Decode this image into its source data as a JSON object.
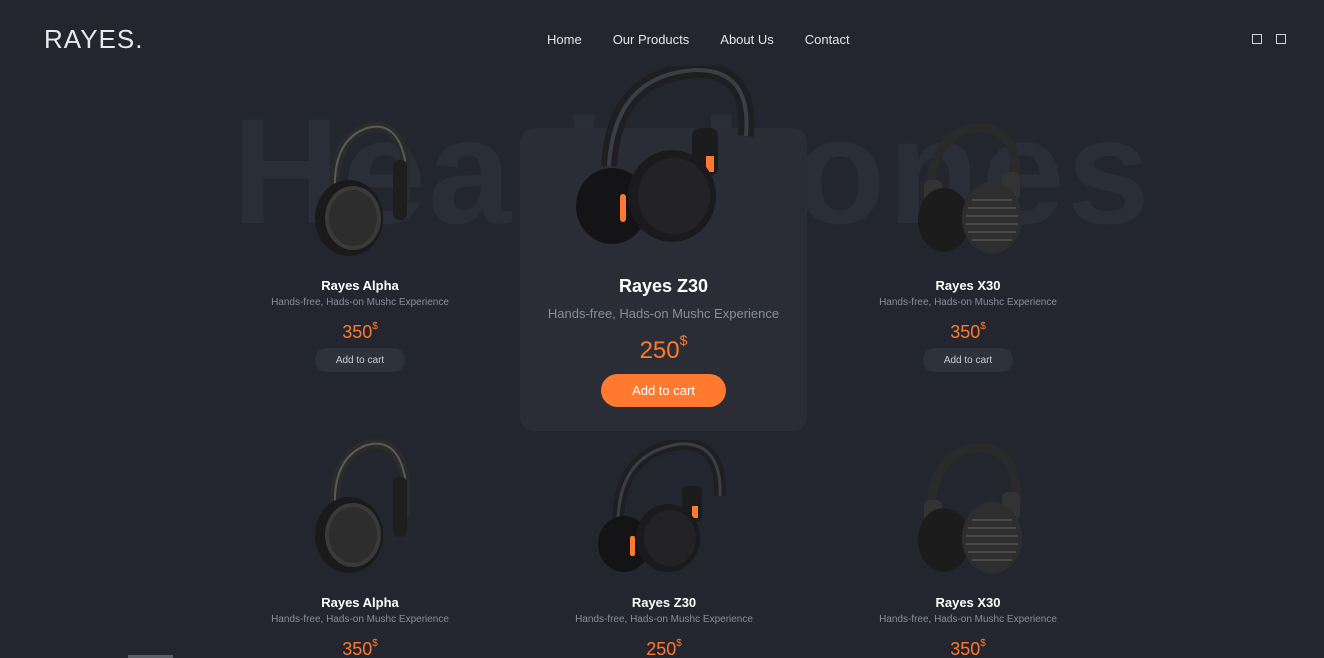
{
  "brand": {
    "logo": "RAYES."
  },
  "nav": {
    "items": [
      "Home",
      "Our Products",
      "About Us",
      "Contact"
    ]
  },
  "header_icons": [
    "cart-icon",
    "user-icon"
  ],
  "hero": {
    "watermark": "Headphones"
  },
  "currency": "$",
  "featured": {
    "name": "Rayes Z30",
    "description": "Hands-free, Hads-on Mushc Experience",
    "price": "250",
    "button": "Add to cart"
  },
  "products": [
    {
      "name": "Rayes Alpha",
      "description": "Hands-free, Hads-on Mushc Experience",
      "price": "350",
      "button": "Add to cart",
      "style": "alpha"
    },
    {
      "name": "Rayes X30",
      "description": "Hands-free, Hads-on Mushc Experience",
      "price": "350",
      "button": "Add to cart",
      "style": "x30"
    },
    {
      "name": "Rayes Alpha",
      "description": "Hands-free, Hads-on Mushc Experience",
      "price": "350",
      "style": "alpha"
    },
    {
      "name": "Rayes Z30",
      "description": "Hands-free, Hads-on Mushc Experience",
      "price": "250",
      "style": "z30"
    },
    {
      "name": "Rayes X30",
      "description": "Hands-free, Hads-on Mushc Experience",
      "price": "350",
      "style": "x30"
    }
  ],
  "colors": {
    "background": "#23262f",
    "accent": "#ff7a2e",
    "card": "#2a2d36"
  }
}
